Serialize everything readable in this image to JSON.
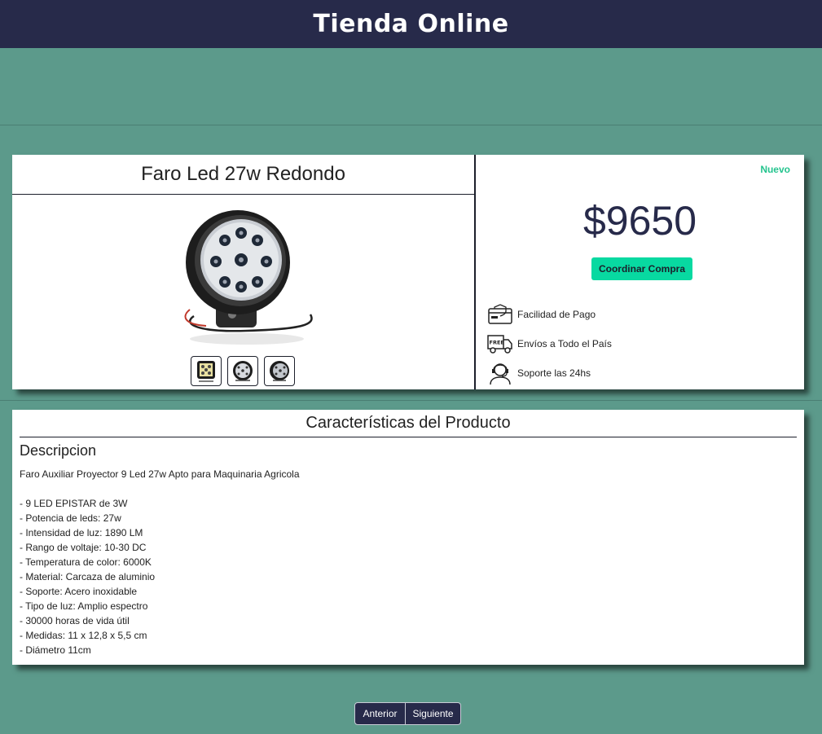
{
  "header": {
    "title": "Tienda Online"
  },
  "product": {
    "title": "Faro Led 27w Redondo",
    "badge": "Nuevo",
    "price": "$9650",
    "buy_label": "Coordinar Compra",
    "thumbnails": [
      "thumb-square",
      "thumb-round-front",
      "thumb-round-angle"
    ],
    "features": [
      {
        "icon": "payment-icon",
        "label": "Facilidad de Pago"
      },
      {
        "icon": "free-shipping-truck-icon",
        "label": "Envíos a Todo el País"
      },
      {
        "icon": "support-agent-icon",
        "label": "Soporte las 24hs"
      }
    ]
  },
  "specs": {
    "title": "Características del Producto",
    "heading": "Descripcion",
    "lines": [
      "Faro Auxiliar Proyector 9 Led 27w Apto para Maquinaria Agricola",
      "",
      "- 9 LED EPISTAR de 3W",
      "- Potencia de leds: 27w",
      "- Intensidad de luz: 1890 LM",
      "- Rango de voltaje: 10-30 DC",
      "- Temperatura de color: 6000K",
      "- Material: Carcaza de aluminio",
      "- Soporte: Acero inoxidable",
      "- Tipo de luz: Amplio espectro",
      "- 30000 horas de vida útil",
      "- Medidas: 11 x 12,8 x 5,5 cm",
      "- Diámetro 11cm"
    ]
  },
  "pager": {
    "prev": "Anterior",
    "next": "Siguiente"
  },
  "colors": {
    "header": "#272a4a",
    "background": "#5c9a8b",
    "accent": "#08d9a1",
    "badge": "#24c48e"
  }
}
